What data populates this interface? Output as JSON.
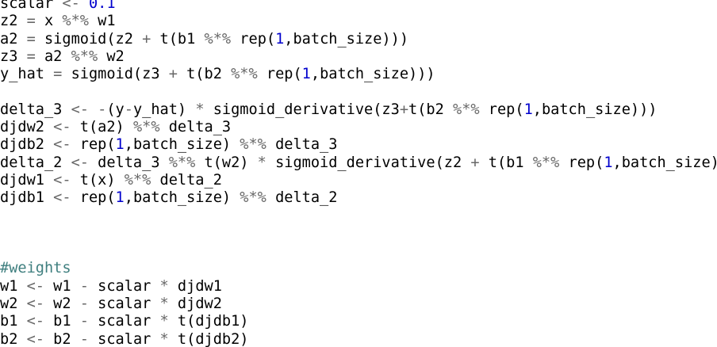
{
  "editor": {
    "token_colors": {
      "identifier": "#000000",
      "operator": "#686868",
      "number": "#0000cd",
      "comment": "#3f7f7f",
      "background": "#ffffff"
    },
    "lines": [
      [
        [
          "id",
          "scalar "
        ],
        [
          "op",
          "<-"
        ],
        [
          "plain",
          " "
        ],
        [
          "num",
          "0.1"
        ]
      ],
      [
        [
          "id",
          "z2 "
        ],
        [
          "op",
          "="
        ],
        [
          "plain",
          " x "
        ],
        [
          "op",
          "%*%"
        ],
        [
          "plain",
          " w1"
        ]
      ],
      [
        [
          "id",
          "a2 "
        ],
        [
          "op",
          "="
        ],
        [
          "plain",
          " sigmoid("
        ],
        [
          "plain",
          "z2 "
        ],
        [
          "op",
          "+"
        ],
        [
          "plain",
          " t(b1 "
        ],
        [
          "op",
          "%*%"
        ],
        [
          "plain",
          " rep("
        ],
        [
          "num",
          "1"
        ],
        [
          "plain",
          ",batch_size)))"
        ]
      ],
      [
        [
          "id",
          "z3 "
        ],
        [
          "op",
          "="
        ],
        [
          "plain",
          " a2 "
        ],
        [
          "op",
          "%*%"
        ],
        [
          "plain",
          " w2"
        ]
      ],
      [
        [
          "id",
          "y_hat "
        ],
        [
          "op",
          "="
        ],
        [
          "plain",
          " sigmoid(z3 "
        ],
        [
          "op",
          "+"
        ],
        [
          "plain",
          " t(b2 "
        ],
        [
          "op",
          "%*%"
        ],
        [
          "plain",
          " rep("
        ],
        [
          "num",
          "1"
        ],
        [
          "plain",
          ",batch_size)))"
        ]
      ],
      [],
      [
        [
          "id",
          "delta_3 "
        ],
        [
          "op",
          "<-"
        ],
        [
          "plain",
          " "
        ],
        [
          "op",
          "-"
        ],
        [
          "plain",
          "(y"
        ],
        [
          "op",
          "-"
        ],
        [
          "plain",
          "y_hat) "
        ],
        [
          "op",
          "*"
        ],
        [
          "plain",
          " sigmoid_derivative(z3"
        ],
        [
          "op",
          "+"
        ],
        [
          "plain",
          "t(b2 "
        ],
        [
          "op",
          "%*%"
        ],
        [
          "plain",
          " rep("
        ],
        [
          "num",
          "1"
        ],
        [
          "plain",
          ",batch_size)))"
        ]
      ],
      [
        [
          "id",
          "djdw2 "
        ],
        [
          "op",
          "<-"
        ],
        [
          "plain",
          " t(a2) "
        ],
        [
          "op",
          "%*%"
        ],
        [
          "plain",
          " delta_3"
        ]
      ],
      [
        [
          "id",
          "djdb2 "
        ],
        [
          "op",
          "<-"
        ],
        [
          "plain",
          " rep("
        ],
        [
          "num",
          "1"
        ],
        [
          "plain",
          ",batch_size) "
        ],
        [
          "op",
          "%*%"
        ],
        [
          "plain",
          " delta_3"
        ]
      ],
      [
        [
          "id",
          "delta_2 "
        ],
        [
          "op",
          "<-"
        ],
        [
          "plain",
          " delta_3 "
        ],
        [
          "op",
          "%*%"
        ],
        [
          "plain",
          " t(w2) "
        ],
        [
          "op",
          "*"
        ],
        [
          "plain",
          " sigmoid_derivative(z2 "
        ],
        [
          "op",
          "+"
        ],
        [
          "plain",
          " t(b1 "
        ],
        [
          "op",
          "%*%"
        ],
        [
          "plain",
          " rep("
        ],
        [
          "num",
          "1"
        ],
        [
          "plain",
          ",batch_size)))"
        ]
      ],
      [
        [
          "id",
          "djdw1 "
        ],
        [
          "op",
          "<-"
        ],
        [
          "plain",
          " t(x) "
        ],
        [
          "op",
          "%*%"
        ],
        [
          "plain",
          " delta_2"
        ]
      ],
      [
        [
          "id",
          "djdb1 "
        ],
        [
          "op",
          "<-"
        ],
        [
          "plain",
          " rep("
        ],
        [
          "num",
          "1"
        ],
        [
          "plain",
          ",batch_size) "
        ],
        [
          "op",
          "%*%"
        ],
        [
          "plain",
          " delta_2"
        ]
      ],
      [],
      [],
      [],
      [
        [
          "comment",
          "#weights"
        ]
      ],
      [
        [
          "id",
          "w1 "
        ],
        [
          "op",
          "<-"
        ],
        [
          "plain",
          " w1 "
        ],
        [
          "op",
          "-"
        ],
        [
          "plain",
          " scalar "
        ],
        [
          "op",
          "*"
        ],
        [
          "plain",
          " djdw1"
        ]
      ],
      [
        [
          "id",
          "w2 "
        ],
        [
          "op",
          "<-"
        ],
        [
          "plain",
          " w2 "
        ],
        [
          "op",
          "-"
        ],
        [
          "plain",
          " scalar "
        ],
        [
          "op",
          "*"
        ],
        [
          "plain",
          " djdw2"
        ]
      ],
      [
        [
          "id",
          "b1 "
        ],
        [
          "op",
          "<-"
        ],
        [
          "plain",
          " b1 "
        ],
        [
          "op",
          "-"
        ],
        [
          "plain",
          " scalar "
        ],
        [
          "op",
          "*"
        ],
        [
          "plain",
          " t(djdb1)"
        ]
      ],
      [
        [
          "id",
          "b2 "
        ],
        [
          "op",
          "<-"
        ],
        [
          "plain",
          " b2 "
        ],
        [
          "op",
          "-"
        ],
        [
          "plain",
          " scalar "
        ],
        [
          "op",
          "*"
        ],
        [
          "plain",
          " t(djdb2)"
        ]
      ]
    ]
  }
}
